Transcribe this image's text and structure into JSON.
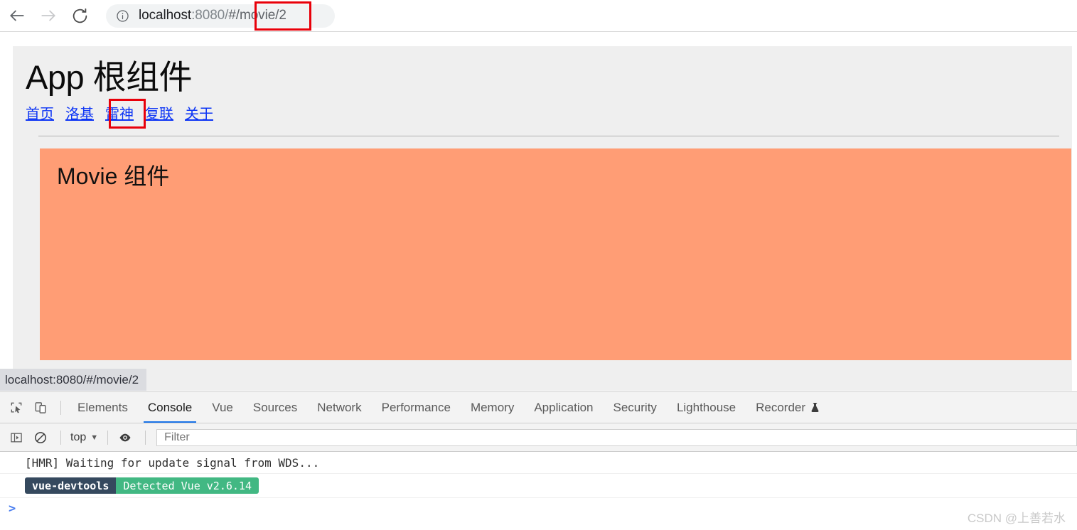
{
  "browser": {
    "back_label": "Back",
    "forward_label": "Forward",
    "reload_label": "Reload",
    "site_info_label": "View site information",
    "url": {
      "host": "localhost",
      "port_and_slash": ":8080/",
      "path": "#/movie/2",
      "full": "localhost:8080/#/movie/2"
    }
  },
  "annotations": {
    "url_box_color": "#e8000a",
    "nav_box_color": "#e8000a"
  },
  "page": {
    "title": "App 根组件",
    "nav": [
      {
        "label": "首页"
      },
      {
        "label": "洛基"
      },
      {
        "label": "雷神"
      },
      {
        "label": "复联"
      },
      {
        "label": "关于"
      }
    ],
    "link_color": "#0d35f5",
    "panel": {
      "title": "Movie 组件",
      "background": "#ff9d75"
    },
    "background": "#efefef",
    "status_bubble": "localhost:8080/#/movie/2"
  },
  "devtools": {
    "toolbar_icons": {
      "inspect": "inspect-element-icon",
      "device": "device-toolbar-icon"
    },
    "tabs": [
      {
        "label": "Elements",
        "active": false
      },
      {
        "label": "Console",
        "active": true
      },
      {
        "label": "Vue",
        "active": false
      },
      {
        "label": "Sources",
        "active": false
      },
      {
        "label": "Network",
        "active": false
      },
      {
        "label": "Performance",
        "active": false
      },
      {
        "label": "Memory",
        "active": false
      },
      {
        "label": "Application",
        "active": false
      },
      {
        "label": "Security",
        "active": false
      },
      {
        "label": "Lighthouse",
        "active": false
      },
      {
        "label": "Recorder",
        "active": false,
        "experimental": true
      }
    ],
    "console_toolbar": {
      "sidebar_label": "Show console sidebar",
      "clear_label": "Clear console",
      "context": "top",
      "live_expression_label": "Create live expression",
      "filter_placeholder": "Filter",
      "filter_value": ""
    },
    "console_messages": [
      {
        "type": "log",
        "text": "[HMR] Waiting for update signal from WDS..."
      }
    ],
    "vue_badge": {
      "left": "vue-devtools",
      "right": "Detected Vue v2.6.14",
      "left_color": "#35495e",
      "right_color": "#42b883"
    },
    "prompt_caret": ">"
  },
  "watermark": "CSDN @上善若水"
}
